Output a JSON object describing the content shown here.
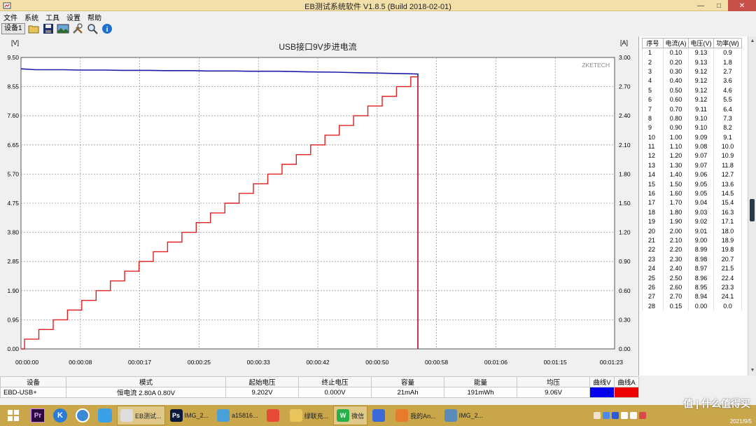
{
  "window": {
    "title": "EB测试系统软件 V1.8.5 (Build 2018-02-01)"
  },
  "menu": [
    "文件",
    "系统",
    "工具",
    "设置",
    "帮助"
  ],
  "toolbar": {
    "device_label": "设备1",
    "icons": [
      "folder-icon",
      "save-icon",
      "image-icon",
      "tools-icon",
      "search-icon",
      "info-icon"
    ]
  },
  "chart_data": {
    "type": "line",
    "title": "USB接口9V步进电流",
    "watermark": "ZKETECH",
    "left_axis": {
      "unit": "[V]",
      "min": 0,
      "max": 9.5,
      "ticks": [
        "0.00",
        "0.95",
        "1.90",
        "2.85",
        "3.80",
        "4.75",
        "5.70",
        "6.65",
        "7.60",
        "8.55",
        "9.50"
      ]
    },
    "right_axis": {
      "unit": "[A]",
      "min": 0,
      "max": 3.0,
      "ticks": [
        "0.00",
        "0.30",
        "0.60",
        "0.90",
        "1.20",
        "1.50",
        "1.80",
        "2.10",
        "2.40",
        "2.70",
        "3.00"
      ]
    },
    "x_axis": {
      "min_s": 0,
      "max_s": 83,
      "ticks": [
        "00:00:00",
        "00:00:08",
        "00:00:17",
        "00:00:25",
        "00:00:33",
        "00:00:42",
        "00:00:50",
        "00:00:58",
        "00:01:06",
        "00:01:15",
        "00:01:23"
      ]
    },
    "grid": true,
    "series": [
      {
        "name": "曲线V",
        "color": "#1c1ca8",
        "axis": "left",
        "points": [
          [
            0,
            9.13
          ],
          [
            2,
            9.1
          ],
          [
            6,
            9.1
          ],
          [
            8,
            9.09
          ],
          [
            12,
            9.09
          ],
          [
            14,
            9.08
          ],
          [
            18,
            9.08
          ],
          [
            20,
            9.07
          ],
          [
            24,
            9.07
          ],
          [
            26,
            9.06
          ],
          [
            30,
            9.06
          ],
          [
            32,
            9.05
          ],
          [
            36,
            9.05
          ],
          [
            38,
            9.04
          ],
          [
            40,
            9.03
          ],
          [
            44,
            9.02
          ],
          [
            46,
            9.01
          ],
          [
            48,
            9.0
          ],
          [
            50,
            8.99
          ],
          [
            52,
            8.98
          ],
          [
            54,
            8.97
          ],
          [
            55.5,
            8.96
          ],
          [
            55.5,
            0.0
          ]
        ]
      },
      {
        "name": "曲线A",
        "color": "#e02020",
        "axis": "right",
        "current_steps": [
          0.1,
          0.2,
          0.3,
          0.4,
          0.5,
          0.6,
          0.7,
          0.8,
          0.9,
          1.0,
          1.1,
          1.2,
          1.3,
          1.4,
          1.5,
          1.6,
          1.7,
          1.8,
          1.9,
          2.0,
          2.1,
          2.2,
          2.3,
          2.4,
          2.5,
          2.6,
          2.7,
          2.8
        ],
        "step_seconds": 2.0,
        "end_s": 55.5
      }
    ]
  },
  "readings": {
    "headers": [
      "序号",
      "电流(A)",
      "电压(V)",
      "功率(W)"
    ],
    "rows": [
      [
        "1",
        "0.10",
        "9.13",
        "0.9"
      ],
      [
        "2",
        "0.20",
        "9.13",
        "1.8"
      ],
      [
        "3",
        "0.30",
        "9.12",
        "2.7"
      ],
      [
        "4",
        "0.40",
        "9.12",
        "3.6"
      ],
      [
        "5",
        "0.50",
        "9.12",
        "4.6"
      ],
      [
        "6",
        "0.60",
        "9.12",
        "5.5"
      ],
      [
        "7",
        "0.70",
        "9.11",
        "6.4"
      ],
      [
        "8",
        "0.80",
        "9.10",
        "7.3"
      ],
      [
        "9",
        "0.90",
        "9.10",
        "8.2"
      ],
      [
        "10",
        "1.00",
        "9.09",
        "9.1"
      ],
      [
        "11",
        "1.10",
        "9.08",
        "10.0"
      ],
      [
        "12",
        "1.20",
        "9.07",
        "10.9"
      ],
      [
        "13",
        "1.30",
        "9.07",
        "11.8"
      ],
      [
        "14",
        "1.40",
        "9.06",
        "12.7"
      ],
      [
        "15",
        "1.50",
        "9.05",
        "13.6"
      ],
      [
        "16",
        "1.60",
        "9.05",
        "14.5"
      ],
      [
        "17",
        "1.70",
        "9.04",
        "15.4"
      ],
      [
        "18",
        "1.80",
        "9.03",
        "16.3"
      ],
      [
        "19",
        "1.90",
        "9.02",
        "17.1"
      ],
      [
        "20",
        "2.00",
        "9.01",
        "18.0"
      ],
      [
        "21",
        "2.10",
        "9.00",
        "18.9"
      ],
      [
        "22",
        "2.20",
        "8.99",
        "19.8"
      ],
      [
        "23",
        "2.30",
        "8.98",
        "20.7"
      ],
      [
        "24",
        "2.40",
        "8.97",
        "21.5"
      ],
      [
        "25",
        "2.50",
        "8.96",
        "22.4"
      ],
      [
        "26",
        "2.60",
        "8.95",
        "23.3"
      ],
      [
        "27",
        "2.70",
        "8.94",
        "24.1"
      ],
      [
        "28",
        "0.15",
        "0.00",
        "0.0"
      ]
    ]
  },
  "summary": {
    "headers": [
      "设备",
      "模式",
      "起始电压",
      "终止电压",
      "容量",
      "能量",
      "均压",
      "曲线V",
      "曲线A"
    ],
    "values": [
      "EBD-USB+",
      "恒电流  2.80A  0.80V",
      "9.202V",
      "0.000V",
      "21mAh",
      "191mWh",
      "9.06V"
    ],
    "curve_v_color": "#0000ee",
    "curve_a_color": "#ee0000"
  },
  "taskbar": {
    "tasks": [
      {
        "label": "EB测试...",
        "icon": "app-icon",
        "active": true
      },
      {
        "label": "IMG_2...",
        "icon": "photoshop-icon",
        "active": false
      },
      {
        "label": "a15816...",
        "icon": "cloud-icon",
        "active": false
      },
      {
        "label": "",
        "icon": "chrome-icon",
        "active": false
      },
      {
        "label": "绿联充...",
        "icon": "folder-icon",
        "active": false
      },
      {
        "label": "微信",
        "icon": "wechat-icon",
        "active": true
      },
      {
        "label": "",
        "icon": "phone-icon",
        "active": false
      },
      {
        "label": "我的An...",
        "icon": "android-icon",
        "active": false
      },
      {
        "label": "IMG_2...",
        "icon": "image-icon",
        "active": false
      }
    ],
    "watermark": "值 | 什么值得买",
    "clock_date": "2021/9/5"
  }
}
